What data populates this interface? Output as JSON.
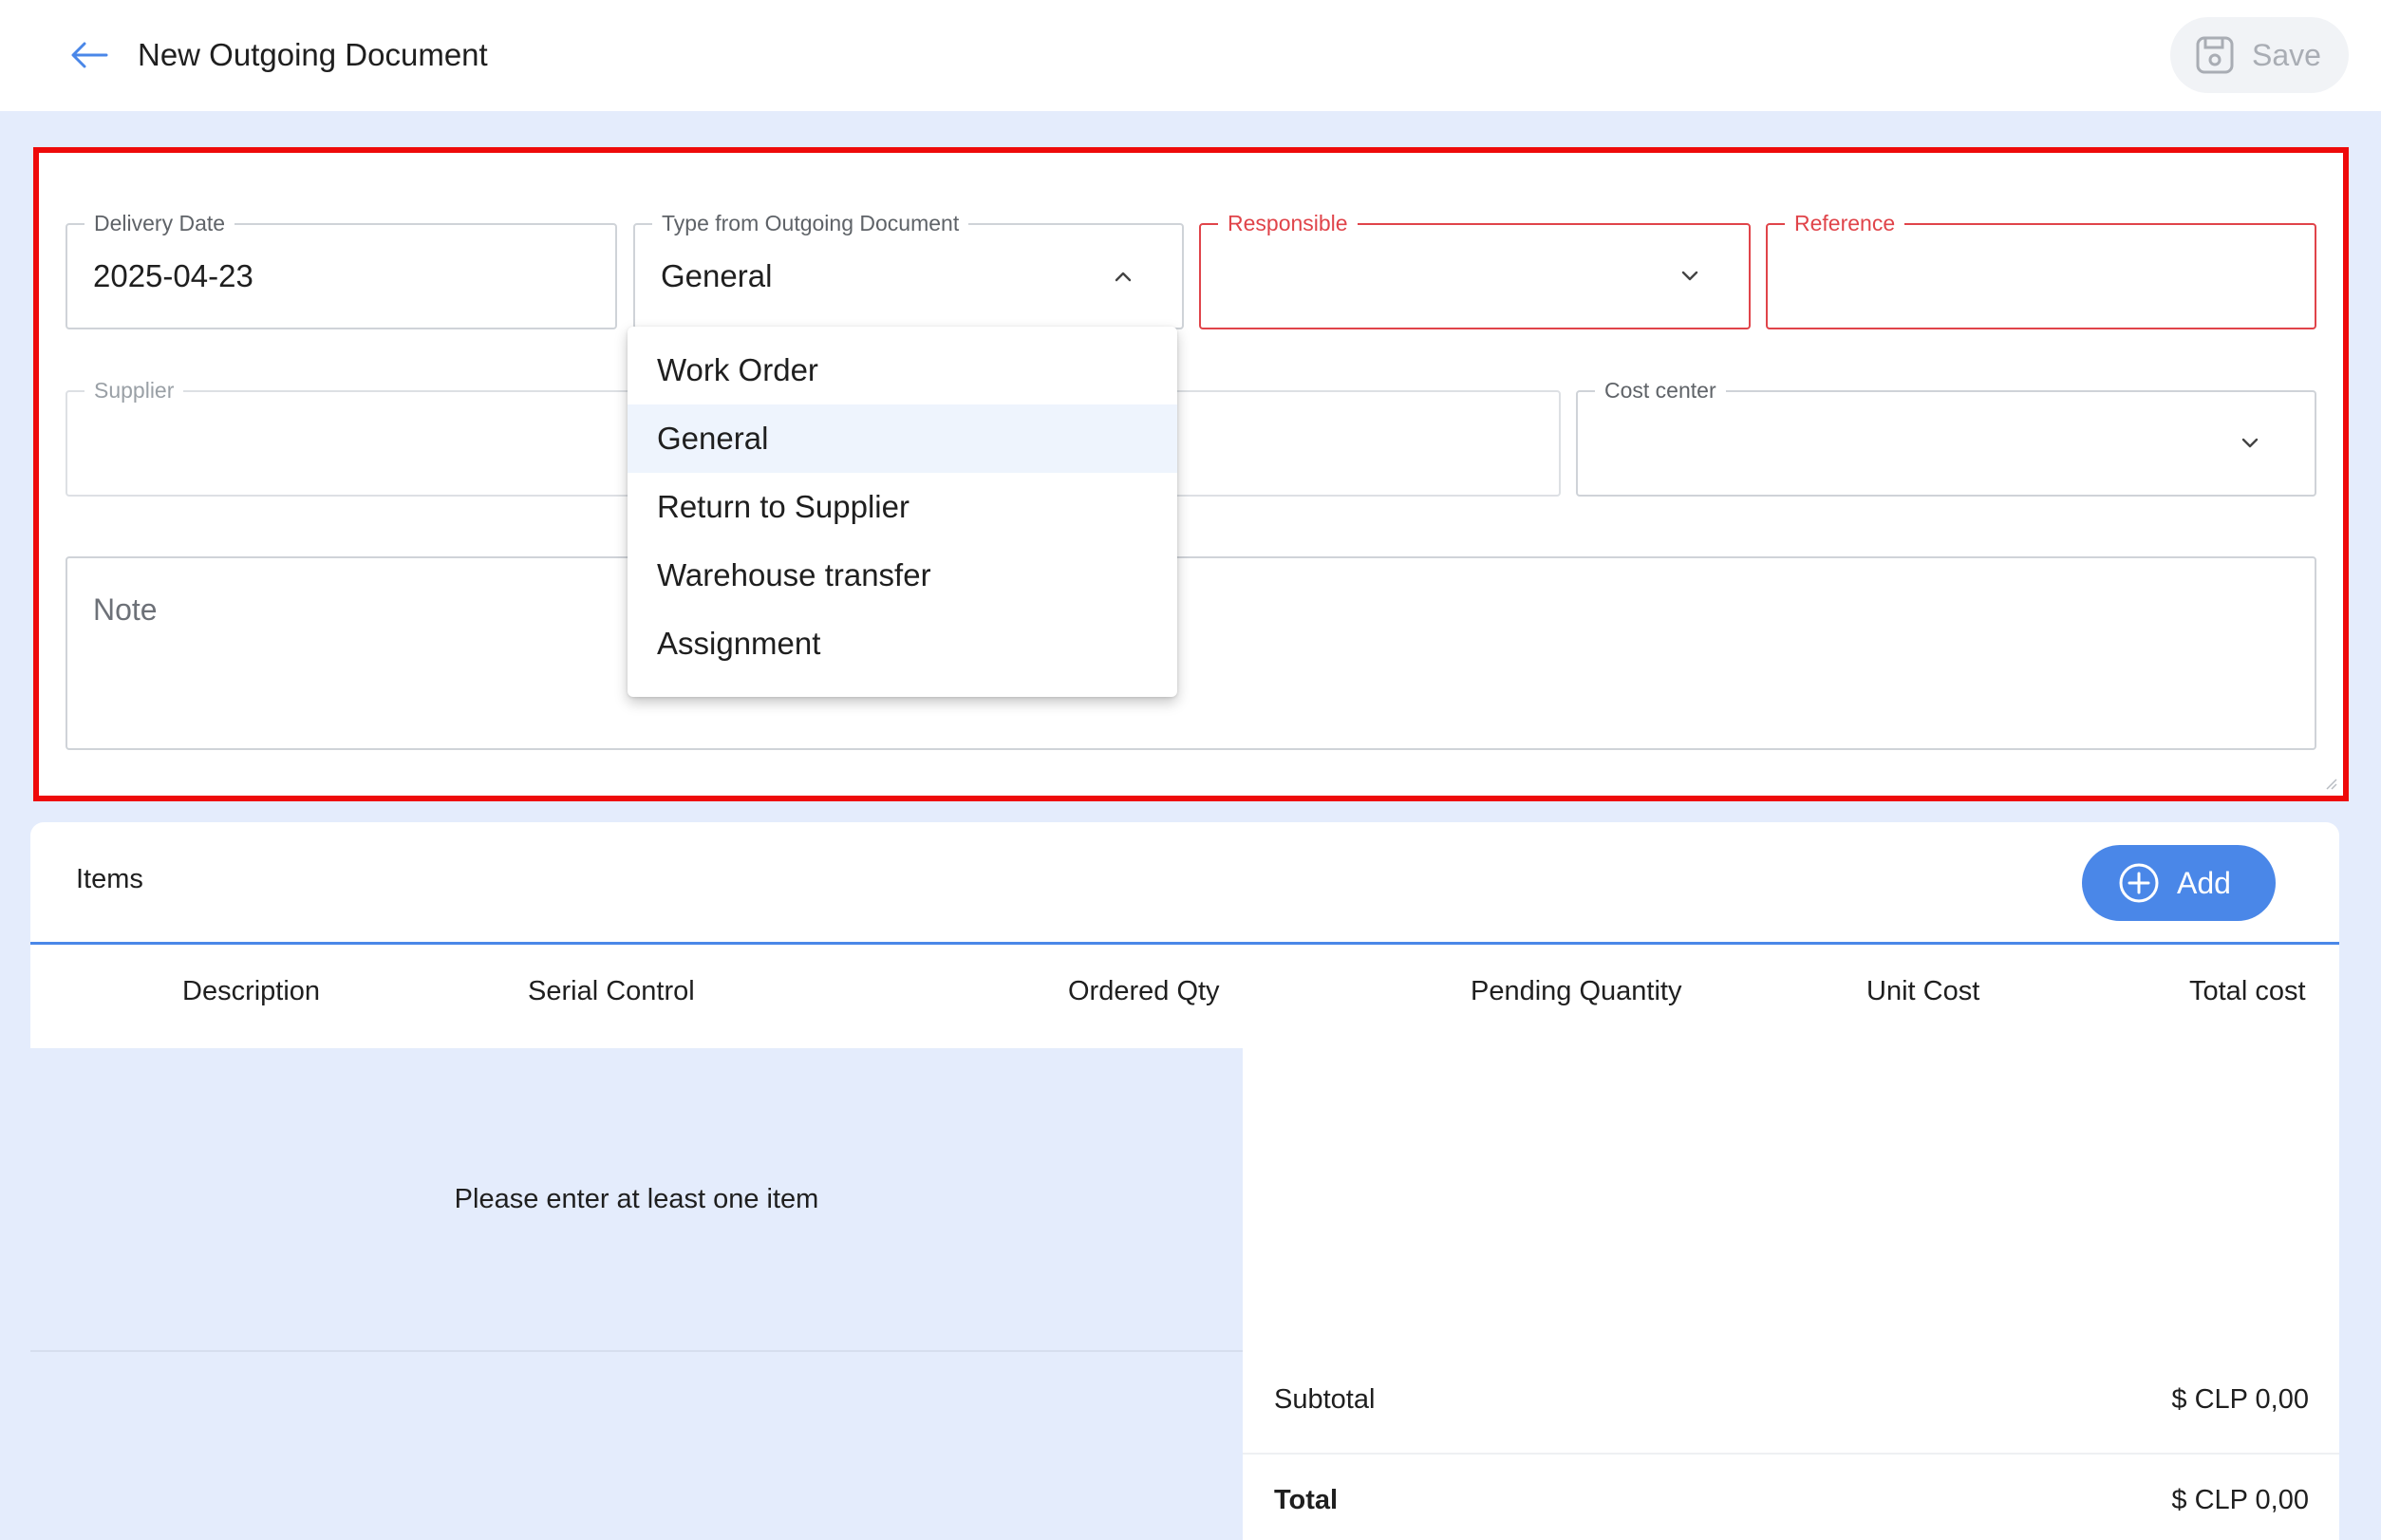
{
  "header": {
    "title": "New Outgoing Document",
    "save_label": "Save"
  },
  "form": {
    "delivery_date": {
      "label": "Delivery Date",
      "value": "2025-04-23"
    },
    "type": {
      "label": "Type from Outgoing Document",
      "value": "General"
    },
    "responsible": {
      "label": "Responsible",
      "value": ""
    },
    "reference": {
      "label": "Reference",
      "value": ""
    },
    "supplier": {
      "label": "Supplier",
      "value": ""
    },
    "cost_center": {
      "label": "Cost center",
      "value": ""
    },
    "note": {
      "placeholder": "Note"
    }
  },
  "dropdown": {
    "options": [
      "Work Order",
      "General",
      "Return to Supplier",
      "Warehouse transfer",
      "Assignment"
    ],
    "selected": "General"
  },
  "items": {
    "title": "Items",
    "add_label": "Add",
    "columns": [
      "Description",
      "Serial Control",
      "Ordered Qty",
      "Pending Quantity",
      "Unit Cost",
      "Total cost"
    ],
    "empty_message": "Please enter at least one item",
    "subtotal_label": "Subtotal",
    "subtotal_value": "$ CLP 0,00",
    "total_label": "Total",
    "total_value": "$ CLP 0,00"
  },
  "colors": {
    "accent": "#4a87e8",
    "error": "#e0444a",
    "highlight": "#ee0a0a",
    "background": "#e4ecfc"
  }
}
